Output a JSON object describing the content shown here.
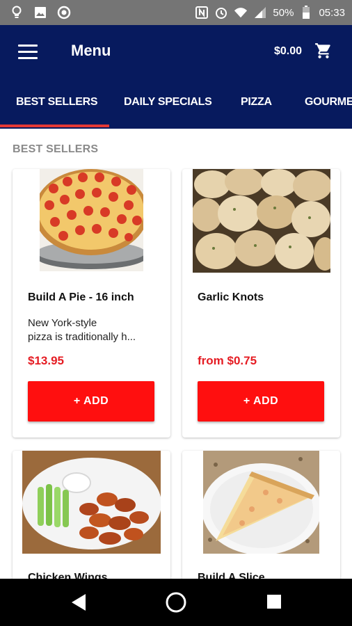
{
  "status_bar": {
    "battery": "50%",
    "time": "05:33"
  },
  "app_bar": {
    "title": "Menu",
    "cart_total": "$0.00"
  },
  "tabs": [
    {
      "label": "BEST SELLERS",
      "active": true
    },
    {
      "label": "DAILY SPECIALS",
      "active": false
    },
    {
      "label": "PIZZA",
      "active": false
    },
    {
      "label": "GOURME",
      "active": false
    }
  ],
  "section": {
    "label": "BEST SELLERS"
  },
  "items": [
    {
      "name": "Build A Pie - 16 inch",
      "description_line1": "New York-style",
      "description_line2": "pizza is traditionally h...",
      "price": "$13.95",
      "add_label": "+ ADD"
    },
    {
      "name": "Garlic Knots",
      "description_line1": "",
      "description_line2": "",
      "price": "from $0.75",
      "add_label": "+ ADD"
    },
    {
      "name": "Chicken Wings"
    },
    {
      "name": "Build A Slice"
    }
  ],
  "colors": {
    "primary": "#071a5e",
    "accent": "#ff0f0f",
    "price": "#e51c23"
  }
}
